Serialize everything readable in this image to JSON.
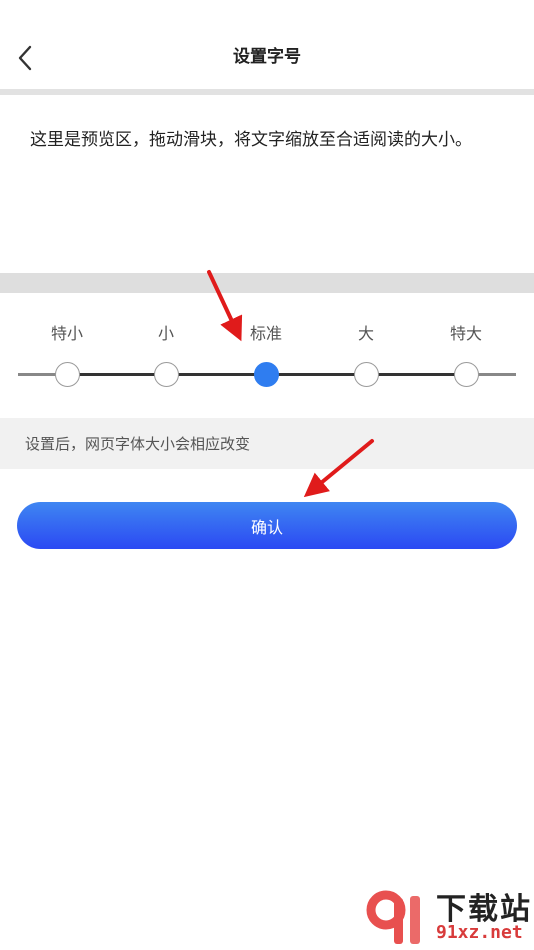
{
  "header": {
    "title": "设置字号",
    "back_icon": "chevron-left-icon"
  },
  "preview": {
    "text": "这里是预览区，拖动滑块，将文字缩放至合适阅读的大小。"
  },
  "font_size": {
    "options": [
      "特小",
      "小",
      "标准",
      "大",
      "特大"
    ],
    "selected_index": 2,
    "selected_label": "标准",
    "accent_color": "#2f7df0"
  },
  "hint": {
    "text": "设置后，网页字体大小会相应改变"
  },
  "confirm": {
    "label": "确认"
  },
  "watermark": {
    "title": "下载站",
    "url": "91xz.net"
  }
}
